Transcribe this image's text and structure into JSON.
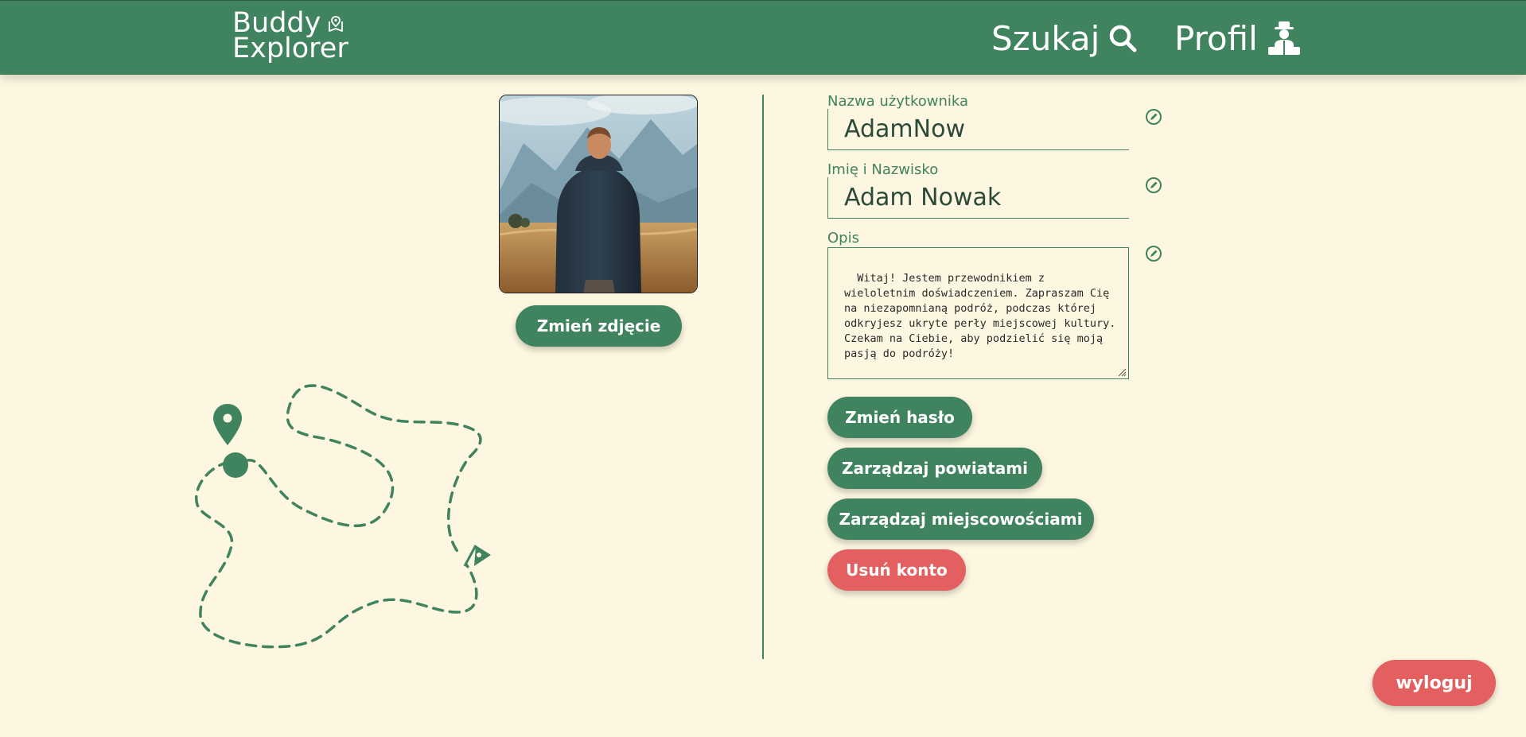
{
  "header": {
    "logo_line1": "Buddy",
    "logo_line2": "Explorer",
    "nav": {
      "search_label": "Szukaj",
      "profile_label": "Profil"
    }
  },
  "profile": {
    "change_photo_label": "Zmień zdjęcie",
    "fields": {
      "username_label": "Nazwa użytkownika",
      "username_value": "AdamNow",
      "fullname_label": "Imię i Nazwisko",
      "fullname_value": "Adam Nowak",
      "description_label": "Opis",
      "description_value": "Witaj! Jestem przewodnikiem z wieloletnim doświadczeniem. Zapraszam Cię na niezapomnianą podróż, podczas której odkryjesz ukryte perły miejscowej kultury. Czekam na Ciebie, aby podzielić się moją pasją do podróży!"
    },
    "actions": {
      "change_password": "Zmień hasło",
      "manage_counties": "Zarządzaj powiatami",
      "manage_towns": "Zarządzaj miejscowościami",
      "delete_account": "Usuń konto"
    }
  },
  "logout_label": "wyloguj",
  "icons": {
    "logo": "map-marker-icon",
    "search": "search-icon",
    "profile": "guide-icon",
    "edit": "pencil-edit-icon",
    "route_start": "location-pin-icon",
    "route_end": "flag-icon"
  },
  "colors": {
    "primary": "#3f835f",
    "danger": "#e45f5f",
    "background": "#fdf6e0"
  }
}
